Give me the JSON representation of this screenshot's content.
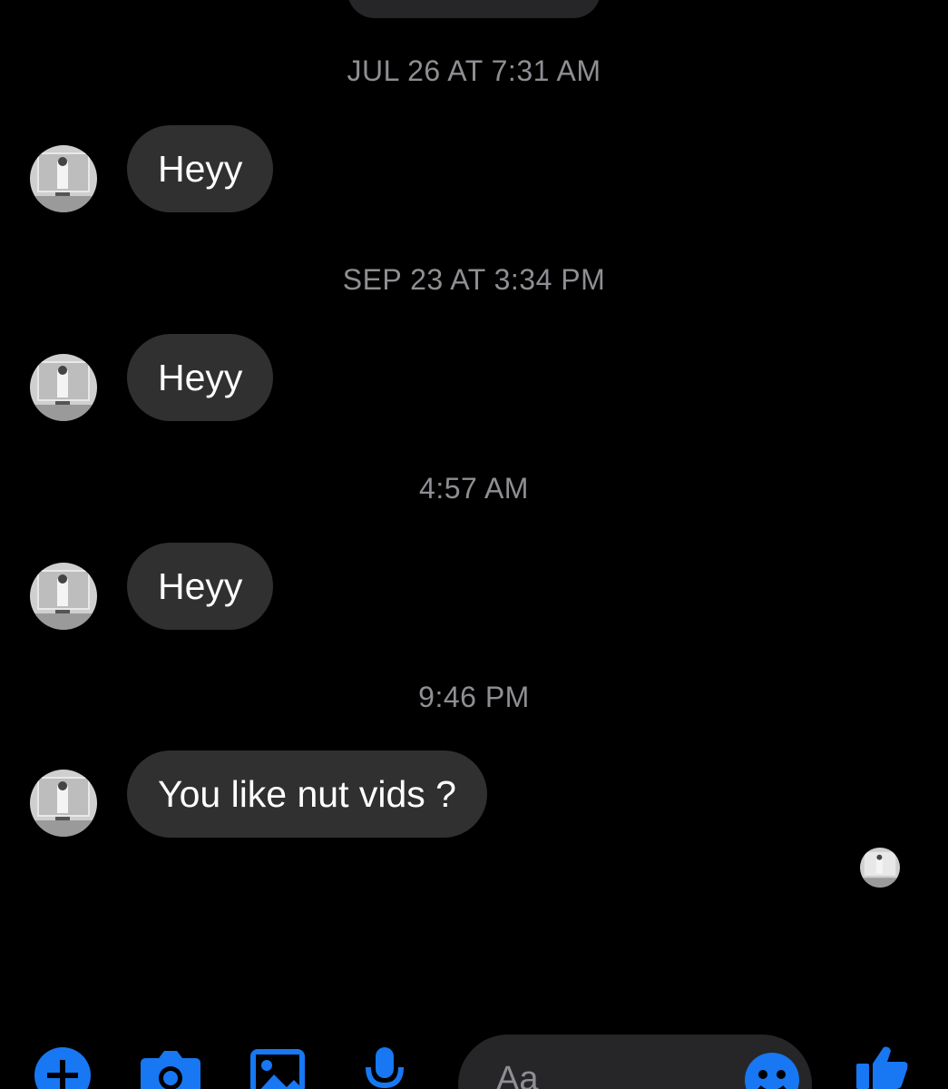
{
  "conversation": {
    "messages": [
      {
        "timestamp": "JUL 26 AT 7:31 AM",
        "text": "Heyy"
      },
      {
        "timestamp": "SEP 23 AT 3:34 PM",
        "text": "Heyy"
      },
      {
        "timestamp": "4:57 AM",
        "text": "Heyy"
      },
      {
        "timestamp": "9:46 PM",
        "text": "You like nut vids ?"
      }
    ]
  },
  "composer": {
    "placeholder": "Aa",
    "icons": [
      "plus-icon",
      "camera-icon",
      "gallery-icon",
      "microphone-icon",
      "emoji-icon",
      "thumbs-up-icon"
    ]
  },
  "colors": {
    "background": "#000000",
    "bubble": "#303030",
    "timestamp": "#8e8e93",
    "accent": "#1877f2"
  }
}
